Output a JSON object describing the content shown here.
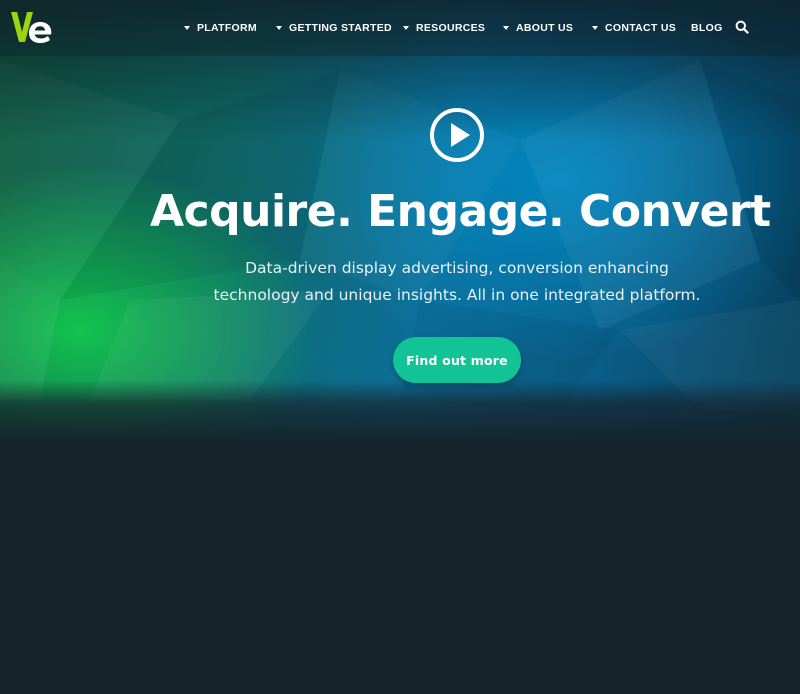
{
  "header": {
    "logo_text": "Ve",
    "nav": [
      {
        "label": "PLATFORM",
        "has_dropdown": true
      },
      {
        "label": "GETTING STARTED",
        "has_dropdown": true
      },
      {
        "label": "RESOURCES",
        "has_dropdown": true
      },
      {
        "label": "ABOUT US",
        "has_dropdown": true
      },
      {
        "label": "CONTACT US",
        "has_dropdown": true
      },
      {
        "label": "BLOG",
        "has_dropdown": false
      }
    ],
    "search_icon": "search-icon"
  },
  "hero": {
    "play_icon": "play-icon",
    "headline": "Acquire. Engage. Convert",
    "subtitle_line1": "Data-driven display advertising, conversion enhancing",
    "subtitle_line2": "technology and unique insights. All in one integrated platform.",
    "cta_label": "Find out more"
  },
  "colors": {
    "logo_v": "#9ed40f",
    "logo_e": "#ffffff",
    "cta_background": "#12c396",
    "page_background": "#15232b",
    "hero_green": "#14c850",
    "hero_blue": "#0d6f9a"
  }
}
